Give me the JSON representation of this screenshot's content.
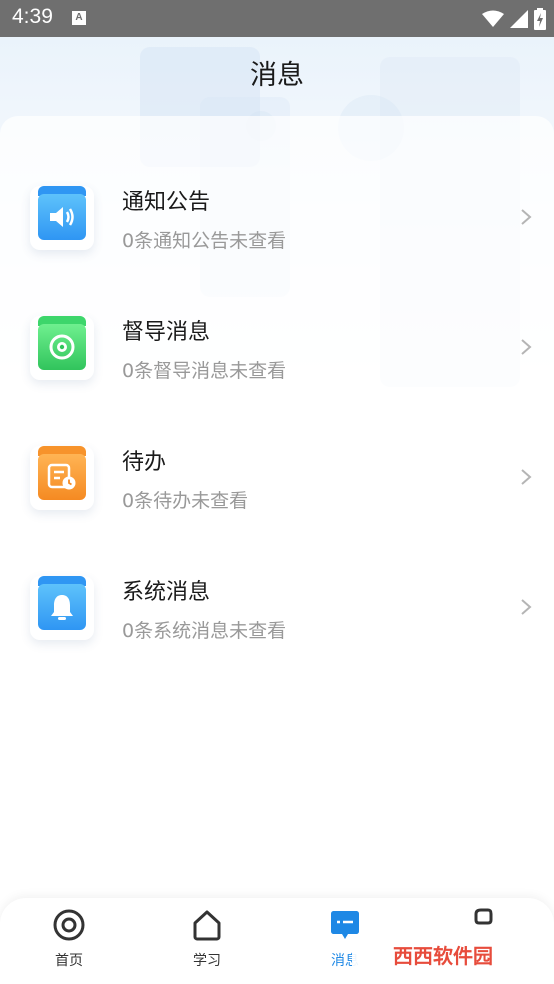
{
  "status_bar": {
    "time": "4:39",
    "ime_label": "A"
  },
  "header": {
    "title": "消息"
  },
  "messages": [
    {
      "name": "通知公告",
      "sub": "0条通知公告未查看",
      "icon": "speaker-icon",
      "color": "#2f96f3"
    },
    {
      "name": "督导消息",
      "sub": "0条督导消息未查看",
      "icon": "supervision-icon",
      "color": "#3dd66b"
    },
    {
      "name": "待办",
      "sub": "0条待办未查看",
      "icon": "todo-icon",
      "color": "#f7932b"
    },
    {
      "name": "系统消息",
      "sub": "0条系统消息未查看",
      "icon": "bell-icon",
      "color": "#2f96f3"
    }
  ],
  "nav": {
    "items": [
      {
        "label": "首页",
        "icon": "home-target-icon"
      },
      {
        "label": "学习",
        "icon": "house-icon"
      },
      {
        "label": "消息",
        "icon": "message-icon",
        "active": true
      },
      {
        "label": "",
        "icon": "profile-icon"
      }
    ],
    "active_color": "#1e88e5"
  },
  "watermark": {
    "text": "西西软件园"
  }
}
